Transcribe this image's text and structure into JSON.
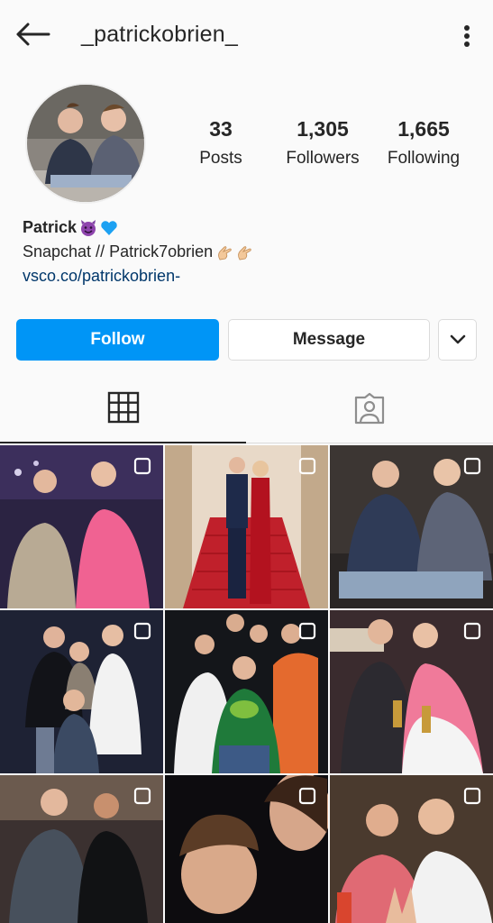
{
  "header": {
    "username": "_patrickobrien_",
    "back_icon": "arrow-left-icon",
    "more_icon": "more-vertical-icon"
  },
  "profile": {
    "stats": {
      "posts": {
        "value": "33",
        "label": "Posts"
      },
      "followers": {
        "value": "1,305",
        "label": "Followers"
      },
      "following": {
        "value": "1,665",
        "label": "Following"
      }
    },
    "name": "Patrick",
    "name_emojis": [
      "smiling-devil-emoji",
      "blue-heart-emoji"
    ],
    "bio_line": "Snapchat // Patrick7obrien",
    "bio_emojis": [
      "pointing-hand-emoji",
      "pointing-hand-emoji"
    ],
    "link": "vsco.co/patrickobrien-"
  },
  "actions": {
    "follow_label": "Follow",
    "message_label": "Message",
    "dropdown_icon": "chevron-down-icon"
  },
  "tabs": [
    {
      "name": "posts-grid",
      "icon": "grid-icon",
      "active": true
    },
    {
      "name": "tagged",
      "icon": "tagged-person-icon",
      "active": false
    }
  ],
  "colors": {
    "accent": "#0095f6",
    "link": "#00376b",
    "text": "#262626",
    "border": "#dbdbdb",
    "background": "#fafafa"
  },
  "grid_posts": [
    {
      "type": "carousel"
    },
    {
      "type": "carousel"
    },
    {
      "type": "carousel"
    },
    {
      "type": "carousel"
    },
    {
      "type": "carousel"
    },
    {
      "type": "carousel"
    },
    {
      "type": "carousel"
    },
    {
      "type": "carousel"
    },
    {
      "type": "carousel"
    }
  ]
}
